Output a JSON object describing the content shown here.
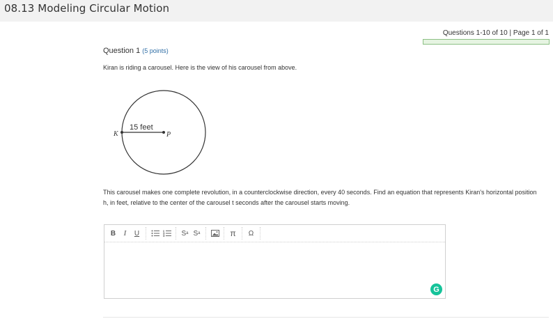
{
  "header": {
    "title": "08.13 Modeling Circular Motion"
  },
  "pager": {
    "text": "Questions 1-10 of 10 | Page 1 of 1",
    "progress_fraction": 0
  },
  "question": {
    "heading": "Question 1",
    "points": "(5 points)",
    "text1": "Kiran is riding a carousel. Here is the view of  his carousel from above.",
    "text2": "This carousel makes one complete revolution, in a counterclockwise direction, every 40 seconds. Find an equation that represents Kiran's horizontal position h, in feet, relative to the center of the carousel t seconds after the carousel starts moving."
  },
  "figure": {
    "radius_label": "15 feet",
    "point_k": "K",
    "point_p": "P"
  },
  "editor": {
    "toolbar": {
      "bold": "B",
      "italic": "I",
      "underline": "U",
      "unordered_list_icon": "list-bullet-icon",
      "ordered_list_icon": "list-number-icon",
      "superscript": "S",
      "superscript_mark": "a",
      "subscript": "S",
      "subscript_mark": "a",
      "image_icon": "image-icon",
      "pi": "π",
      "omega": "Ω"
    },
    "grammarly_icon": "G"
  },
  "colors": {
    "grammarly": "#15c39a",
    "progress_border": "#8cc084",
    "points": "#2f6ea5"
  }
}
